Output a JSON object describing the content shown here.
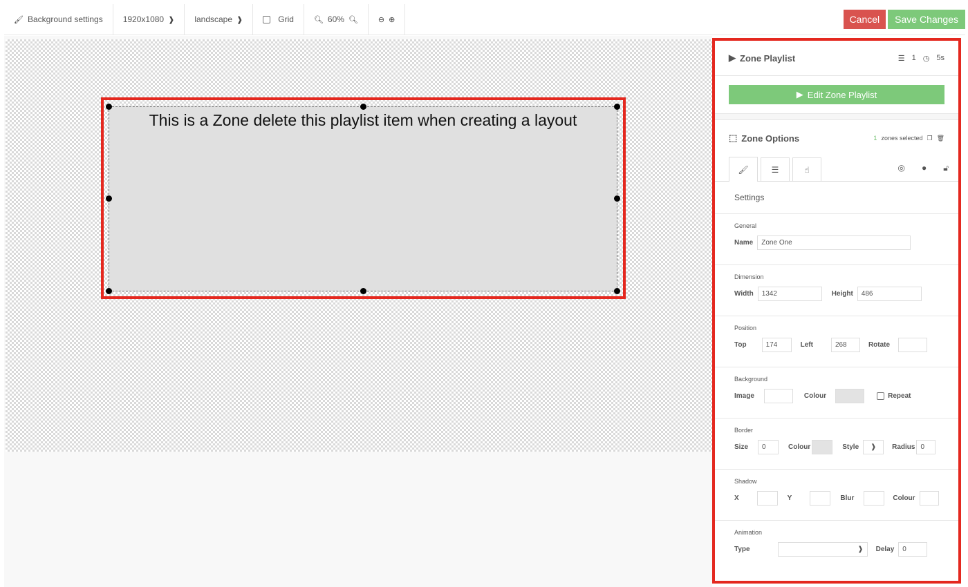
{
  "toolbar": {
    "background_settings": "Background settings",
    "resolution": "1920x1080",
    "orientation": "landscape",
    "grid": "Grid",
    "zoom": "60%",
    "cancel": "Cancel",
    "save": "Save Changes"
  },
  "canvas": {
    "zone_text": "This is a Zone delete this playlist item when creating a layout"
  },
  "playlist": {
    "title": "Zone Playlist",
    "count": "1",
    "duration": "5s",
    "edit_button": "Edit Zone Playlist"
  },
  "zone_options": {
    "title": "Zone Options",
    "selected_count": "1",
    "selected_text": "zones selected"
  },
  "settings": {
    "title": "Settings",
    "general": {
      "title": "General",
      "name_label": "Name",
      "name_value": "Zone One"
    },
    "dimension": {
      "title": "Dimension",
      "width_label": "Width",
      "width_value": "1342",
      "height_label": "Height",
      "height_value": "486"
    },
    "position": {
      "title": "Position",
      "top_label": "Top",
      "top_value": "174",
      "left_label": "Left",
      "left_value": "268",
      "rotate_label": "Rotate",
      "rotate_value": ""
    },
    "background": {
      "title": "Background",
      "image_label": "Image",
      "colour_label": "Colour",
      "repeat_label": "Repeat"
    },
    "border": {
      "title": "Border",
      "size_label": "Size",
      "size_value": "0",
      "colour_label": "Colour",
      "style_label": "Style",
      "radius_label": "Radius",
      "radius_value": "0"
    },
    "shadow": {
      "title": "Shadow",
      "x_label": "X",
      "y_label": "Y",
      "blur_label": "Blur",
      "colour_label": "Colour"
    },
    "animation": {
      "title": "Animation",
      "type_label": "Type",
      "type_value": "",
      "delay_label": "Delay",
      "delay_value": "0"
    }
  },
  "colors": {
    "accent_green": "#7dc97a",
    "cancel_red": "#d9534f",
    "highlight_red": "#e4281f"
  }
}
